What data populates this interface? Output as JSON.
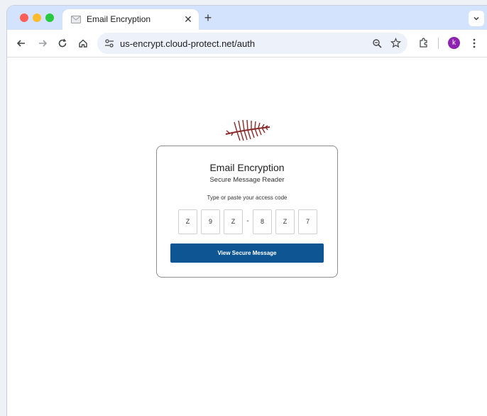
{
  "browser": {
    "tab_title": "Email Encryption",
    "tab_close_icon": "close-icon",
    "new_tab_symbol": "+",
    "url": "us-encrypt.cloud-protect.net/auth",
    "profile_initial": "k"
  },
  "page": {
    "title": "Email Encryption",
    "subtitle": "Secure Message Reader",
    "code_prompt": "Type or paste your access code",
    "code_chars": [
      "Z",
      "9",
      "Z",
      "8",
      "Z",
      "7"
    ],
    "code_separator": "-",
    "submit_label": "View Secure Message"
  },
  "colors": {
    "tab_strip": "#d3e3fd",
    "button": "#0e5594",
    "logo": "#8b2a2a",
    "avatar": "#8d23b0"
  }
}
